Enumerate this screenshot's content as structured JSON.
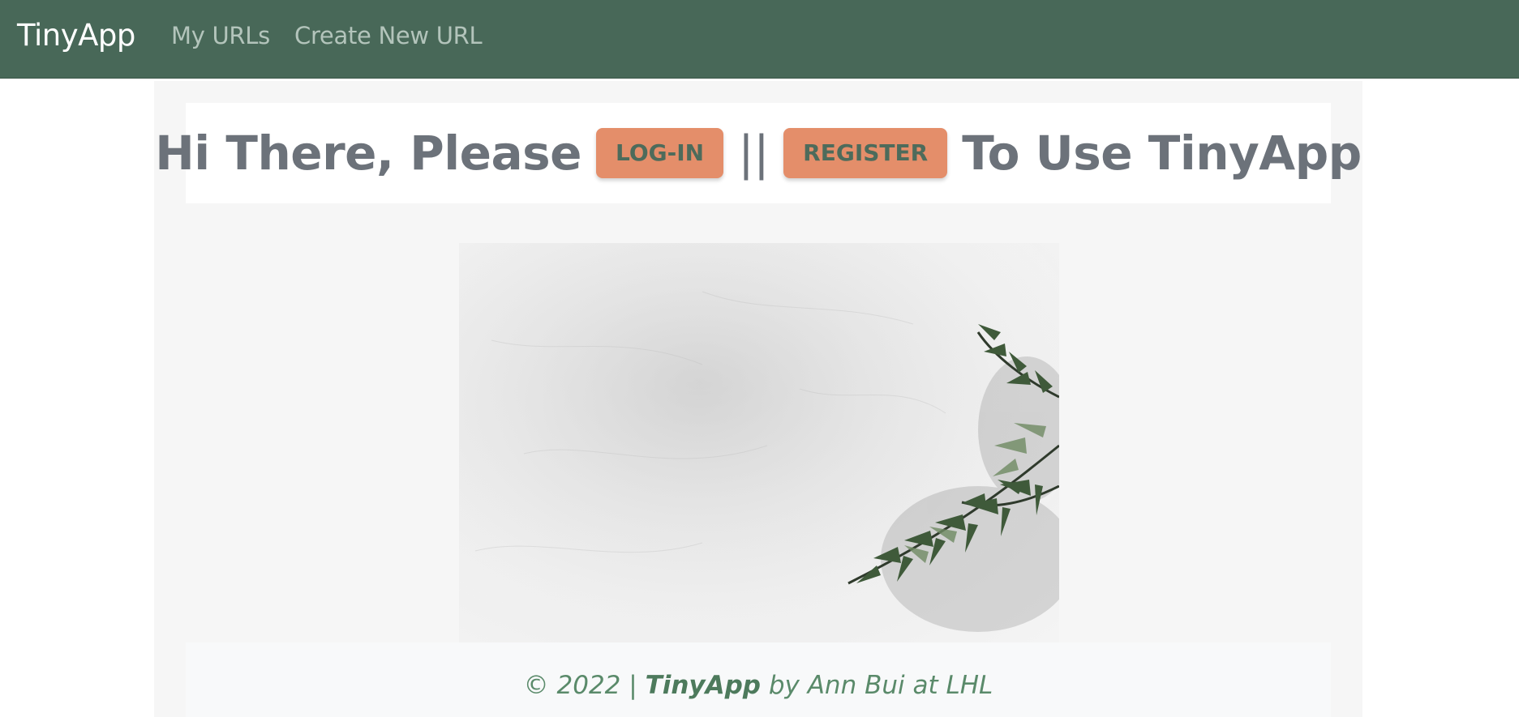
{
  "navbar": {
    "brand": "TinyApp",
    "links": [
      "My URLs",
      "Create New URL"
    ]
  },
  "hero": {
    "prefix": "Hi There, Please",
    "login_button": "LOG-IN",
    "separator": "||",
    "register_button": "REGISTER",
    "suffix": "To Use TinyApp"
  },
  "image": {
    "description_icon": "fern-on-concrete-image"
  },
  "footer": {
    "copyright": "© 2022 |",
    "brand": "TinyApp",
    "credit": "by Ann Bui at LHL"
  },
  "colors": {
    "navbar": "#486858",
    "button": "#e48e6a",
    "button_text": "#4d6b5b",
    "heading_text": "#6c727a",
    "footer_text": "#5a8a6a"
  }
}
